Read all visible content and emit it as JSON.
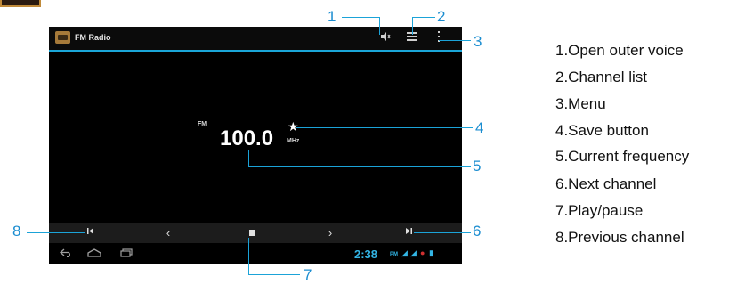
{
  "app": {
    "title": "FM Radio"
  },
  "tuner": {
    "band": "FM",
    "frequency": "100.0",
    "unit": "MHz"
  },
  "status_bar": {
    "time": "2:38",
    "ampm": "PM"
  },
  "icons": {
    "voice": "speaker-icon",
    "list": "list-icon",
    "menu": "overflow-menu-icon",
    "save": "star-icon",
    "prev": "skip-previous-icon",
    "back": "chevron-left-icon",
    "play": "stop-icon",
    "forward": "chevron-right-icon",
    "next": "skip-next-icon"
  },
  "callouts": {
    "n1": "1",
    "n2": "2",
    "n3": "3",
    "n4": "4",
    "n5": "5",
    "n6": "6",
    "n7": "7",
    "n8": "8"
  },
  "legend": [
    "1.Open outer voice",
    "2.Channel list",
    "3.Menu",
    "4.Save button",
    "5.Current frequency",
    "6.Next channel",
    "7.Play/pause",
    "8.Previous channel"
  ],
  "colors": {
    "accent": "#1aa6d8",
    "callout": "#1b8dd0",
    "screen_bg": "#000000"
  }
}
